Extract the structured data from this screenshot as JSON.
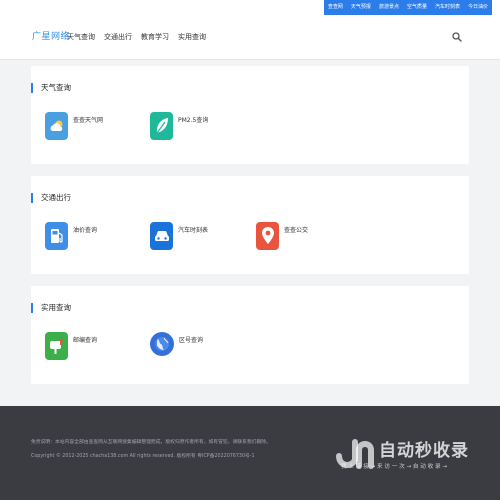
{
  "top_links": [
    "查查网",
    "天气预报",
    "旅游景点",
    "空气质量",
    "汽车时刻表",
    "今日油价"
  ],
  "header": {
    "logo": "广星网络",
    "nav": [
      "天气查询",
      "交通出行",
      "教育学习",
      "实用查询"
    ],
    "search_icon": "search-icon"
  },
  "sections": [
    {
      "title": "天气查询",
      "items": [
        {
          "label": "查查天气网",
          "icon": "weather-cloud-icon",
          "color": "#4a9fe0"
        },
        {
          "label": "PM2.5查询",
          "icon": "leaf-icon",
          "color": "#1fb89a"
        }
      ]
    },
    {
      "title": "交通出行",
      "items": [
        {
          "label": "油价查询",
          "icon": "fuel-pump-icon",
          "color": "#3f8ee8"
        },
        {
          "label": "汽车时刻表",
          "icon": "car-icon",
          "color": "#1a73d9"
        },
        {
          "label": "查查公交",
          "icon": "map-pin-icon",
          "color": "#e8543d"
        }
      ]
    },
    {
      "title": "实用查询",
      "items": [
        {
          "label": "邮编查询",
          "icon": "mailbox-icon",
          "color": "#3cae4a"
        },
        {
          "label": "区号查询",
          "icon": "globe-icon",
          "color": "#3470d8"
        }
      ]
    }
  ],
  "footer": {
    "disclaimer": "免责说明：本站内容全部由查查网从互联网搜集编辑整理而成，版权归原作者所有，如有冒犯，请联系我们删除。",
    "copyright": "Copyright © 2012-2025 chacha138.com All rights reserved. 版权所有 粤ICP备2022076730号-1"
  },
  "watermark": {
    "title": "自动秒收录",
    "subtitle": "我 上 链 接 → 来 访 一 次 → 自 动 收 录 →"
  }
}
